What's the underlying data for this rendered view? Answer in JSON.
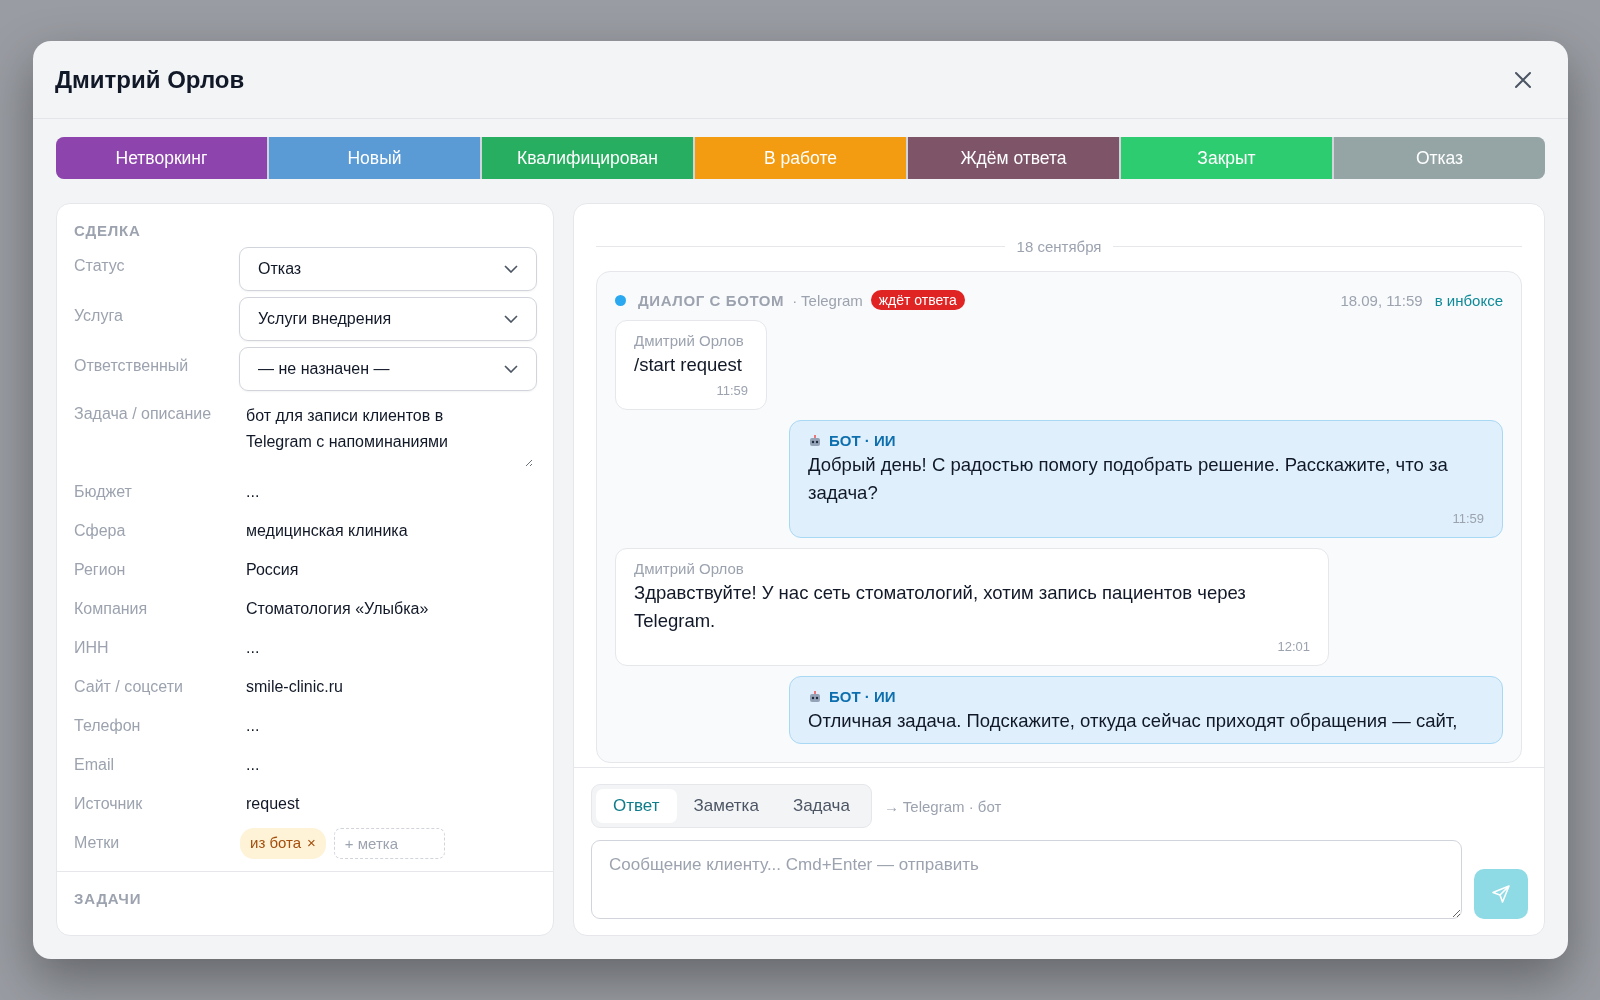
{
  "modal": {
    "title": "Дмитрий Орлов"
  },
  "stages": [
    {
      "label": "Нетворкинг",
      "color": "#8e44ad"
    },
    {
      "label": "Новый",
      "color": "#5b9bd5"
    },
    {
      "label": "Квалифицирован",
      "color": "#27ae60"
    },
    {
      "label": "В работе",
      "color": "#f39c12"
    },
    {
      "label": "Ждём ответа",
      "color": "#7d5468"
    },
    {
      "label": "Закрыт",
      "color": "#2ecc71"
    },
    {
      "label": "Отказ",
      "color": "#95a5a6"
    }
  ],
  "deal": {
    "heading": "СДЕЛКА",
    "fields": [
      {
        "label": "Статус",
        "kind": "select",
        "value": "Отказ"
      },
      {
        "label": "Услуга",
        "kind": "select",
        "value": "Услуги внедрения"
      },
      {
        "label": "Ответственный",
        "kind": "select",
        "value": "— не назначен —"
      },
      {
        "label": "Задача / описание",
        "kind": "textarea",
        "value": "бот для записи клиентов в Telegram с напоминаниями"
      },
      {
        "label": "Бюджет",
        "kind": "text",
        "value": "..."
      },
      {
        "label": "Сфера",
        "kind": "text",
        "value": "медицинская клиника"
      },
      {
        "label": "Регион",
        "kind": "text",
        "value": "Россия"
      },
      {
        "label": "Компания",
        "kind": "text",
        "value": "Стоматология «Улыбка»"
      },
      {
        "label": "ИНН",
        "kind": "text",
        "value": "..."
      },
      {
        "label": "Сайт / соцсети",
        "kind": "text",
        "value": "smile-clinic.ru"
      },
      {
        "label": "Телефон",
        "kind": "text",
        "value": "..."
      },
      {
        "label": "Email",
        "kind": "text",
        "value": "..."
      },
      {
        "label": "Источник",
        "kind": "text",
        "value": "request"
      },
      {
        "label": "Метки",
        "kind": "tags",
        "tags": [
          "из бота"
        ],
        "remove": "×",
        "add_placeholder": "+ метка"
      }
    ]
  },
  "tasks": {
    "heading": "ЗАДАЧИ"
  },
  "chat": {
    "date": "18 сентября",
    "dialog": {
      "title": "ДИАЛОГ С БОТОМ",
      "channel": "· Telegram",
      "badge": "ждёт ответа",
      "time": "18.09, 11:59",
      "link": "в инбоксе",
      "messages": [
        {
          "kind": "client",
          "author": "Дмитрий Орлов",
          "text": "/start request",
          "time": "11:59"
        },
        {
          "kind": "bot",
          "author": "БОТ · ИИ",
          "text": "Добрый день! С радостью помогу подобрать решение. Расскажите, что за задача?",
          "time": "11:59"
        },
        {
          "kind": "client",
          "author": "Дмитрий Орлов",
          "text": "Здравствуйте! У нас сеть стоматологий, хотим запись пациентов через Telegram.",
          "time": "12:01"
        },
        {
          "kind": "bot",
          "author": "БОТ · ИИ",
          "text": "Отличная задача. Подскажите, откуда сейчас приходят обращения — сайт,"
        }
      ]
    }
  },
  "composer": {
    "tabs": [
      {
        "label": "Ответ",
        "selected": true
      },
      {
        "label": "Заметка",
        "selected": false
      },
      {
        "label": "Задача",
        "selected": false
      }
    ],
    "target": "→ Telegram · бот",
    "placeholder": "Сообщение клиенту... Cmd+Enter — отправить",
    "send_disabled": true
  }
}
